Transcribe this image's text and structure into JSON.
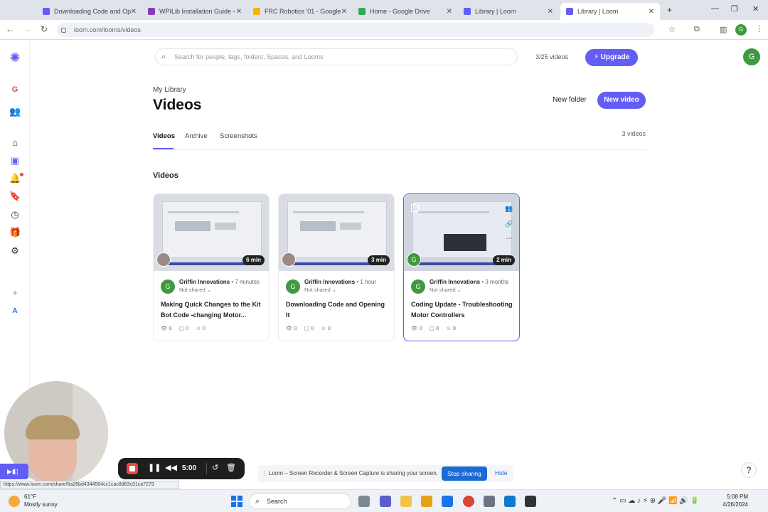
{
  "browser": {
    "tabs": [
      {
        "label": "Downloading Code and Op",
        "color": "#625df5"
      },
      {
        "label": "WPILib Installation Guide -",
        "color": "#8a3ab9"
      },
      {
        "label": "FRC Robotics '01 - Google",
        "color": "#f4b400"
      },
      {
        "label": "Home - Google Drive",
        "color": "#34a853"
      },
      {
        "label": "Library | Loom",
        "color": "#625df5"
      },
      {
        "label": "Library | Loom",
        "color": "#625df5"
      }
    ],
    "url": "loom.com/looms/videos",
    "status_url": "https://www.loom.com/share/6a26bd4344564cc1cac8d63c91ca7279"
  },
  "header": {
    "search_placeholder": "Search for people, tags, folders, Spaces, and Looms",
    "quota": "3/25 videos",
    "upgrade_label": "Upgrade",
    "avatar_initial": "G"
  },
  "sidebar": {
    "workspace_initial": "G",
    "bottom_initial": "A"
  },
  "page": {
    "breadcrumb": "My Library",
    "title": "Videos",
    "new_folder_label": "New folder",
    "new_video_label": "New video",
    "tabs": [
      "Videos",
      "Archive",
      "Screenshots"
    ],
    "video_count": "3 videos",
    "section_title": "Videos"
  },
  "cards": [
    {
      "duration": "6 min",
      "owner": "Griffin Innovations",
      "ago": "• 7 minutes",
      "shared": "Not shared ⌄",
      "title": "Making Quick Changes to the Kit Bot Code -changing Motor...",
      "views": "0",
      "comments": "0",
      "reactions": "0"
    },
    {
      "duration": "3 min",
      "owner": "Griffin Innovations",
      "ago": "• 1 hour",
      "shared": "Not shared ⌄",
      "title": "Downloading Code and Opening It",
      "views": "0",
      "comments": "0",
      "reactions": "0"
    },
    {
      "duration": "2 min",
      "owner": "Griffin Innovations",
      "ago": "• 3 months",
      "shared": "Not shared ⌄",
      "title": "Coding Update - Troubleshooting Motor Controllers",
      "views": "0",
      "comments": "0",
      "reactions": "0"
    }
  ],
  "recording": {
    "timer": "5:00",
    "share_text": "Loom – Screen Recorder & Screen Capture is sharing your screen.",
    "stop_sharing_label": "Stop sharing",
    "hide_label": "Hide"
  },
  "taskbar": {
    "weather_temp": "61°F",
    "weather_desc": "Mostly sunny",
    "search_label": "Search",
    "time": "5:08 PM",
    "date": "4/26/2024"
  },
  "colors": {
    "accent": "#625df5",
    "avatar_green": "#3f9a3f",
    "stop_red": "#e9483a",
    "share_blue": "#1b6bd6"
  }
}
